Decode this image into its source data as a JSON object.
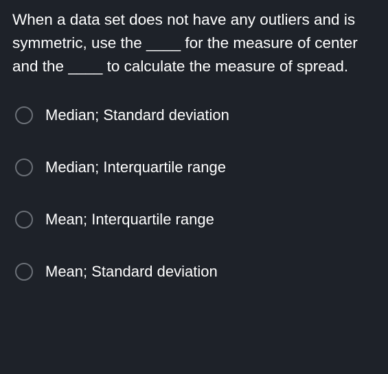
{
  "question": {
    "text": "When a data set does not have any outliers and is symmetric, use the ____ for the measure of center and the ____ to calculate the measure of spread."
  },
  "options": [
    {
      "label": "Median; Standard deviation"
    },
    {
      "label": "Median; Interquartile range"
    },
    {
      "label": "Mean; Interquartile range"
    },
    {
      "label": "Mean; Standard deviation"
    }
  ]
}
